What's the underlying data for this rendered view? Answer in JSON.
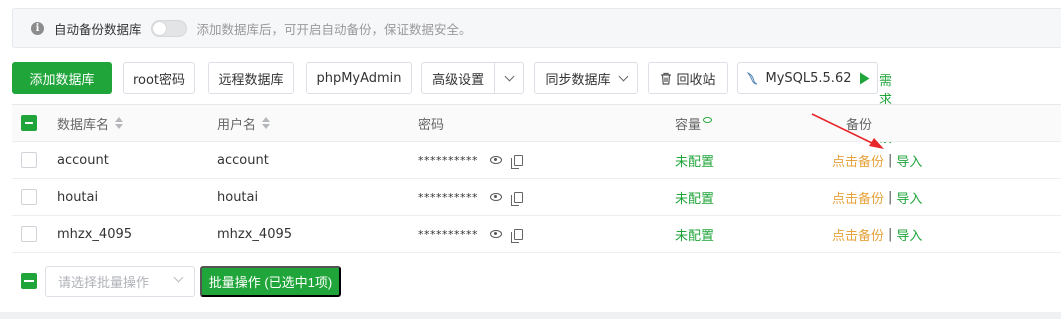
{
  "notice": {
    "auto_backup_label": "自动备份数据库",
    "hint": "添加数据库后，可开启自动备份，保证数据安全。",
    "toggle_on": false
  },
  "toolbar": {
    "add_db": "添加数据库",
    "root_pwd": "root密码",
    "remote_db": "远程数据库",
    "phpmyadmin": "phpMyAdmin",
    "advanced": "高级设置",
    "sync_db": "同步数据库",
    "recycle": "回收站",
    "mysql_version": "MySQL5.5.62",
    "feedback": "需求反馈"
  },
  "table": {
    "headers": {
      "name": "数据库名",
      "user": "用户名",
      "password": "密码",
      "capacity": "容量",
      "backup": "备份"
    },
    "rows": [
      {
        "name": "account",
        "user": "account",
        "password": "**********",
        "capacity": "未配置",
        "backup": "点击备份",
        "import": "导入",
        "sep": "|"
      },
      {
        "name": "houtai",
        "user": "houtai",
        "password": "**********",
        "capacity": "未配置",
        "backup": "点击备份",
        "import": "导入",
        "sep": "|"
      },
      {
        "name": "mhzx_4095",
        "user": "mhzx_4095",
        "password": "**********",
        "capacity": "未配置",
        "backup": "点击备份",
        "import": "导入",
        "sep": "|"
      }
    ]
  },
  "bottom": {
    "select_placeholder": "请选择批量操作",
    "batch_button": "批量操作 (已选中1项)"
  },
  "colors": {
    "accent": "#20a53a",
    "warning": "#e6a23c",
    "annotation_arrow": "#e8262a"
  }
}
